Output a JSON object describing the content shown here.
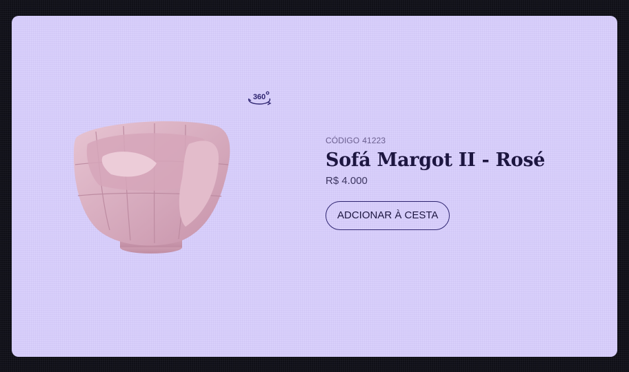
{
  "product": {
    "code_label": "CÓDIGO",
    "code_value": "41223",
    "name": "Sofá Margot II - Rosé",
    "price": "R$ 4.000",
    "add_to_cart_label": "ADCIONAR À CESTA",
    "viewer_icon": "rotate-360-icon",
    "image": "pink-armchair-image"
  },
  "colors": {
    "background": "#d9d0fb",
    "text": "#1d1640",
    "accent": "#2e2470",
    "product": "#ddb3c6"
  }
}
